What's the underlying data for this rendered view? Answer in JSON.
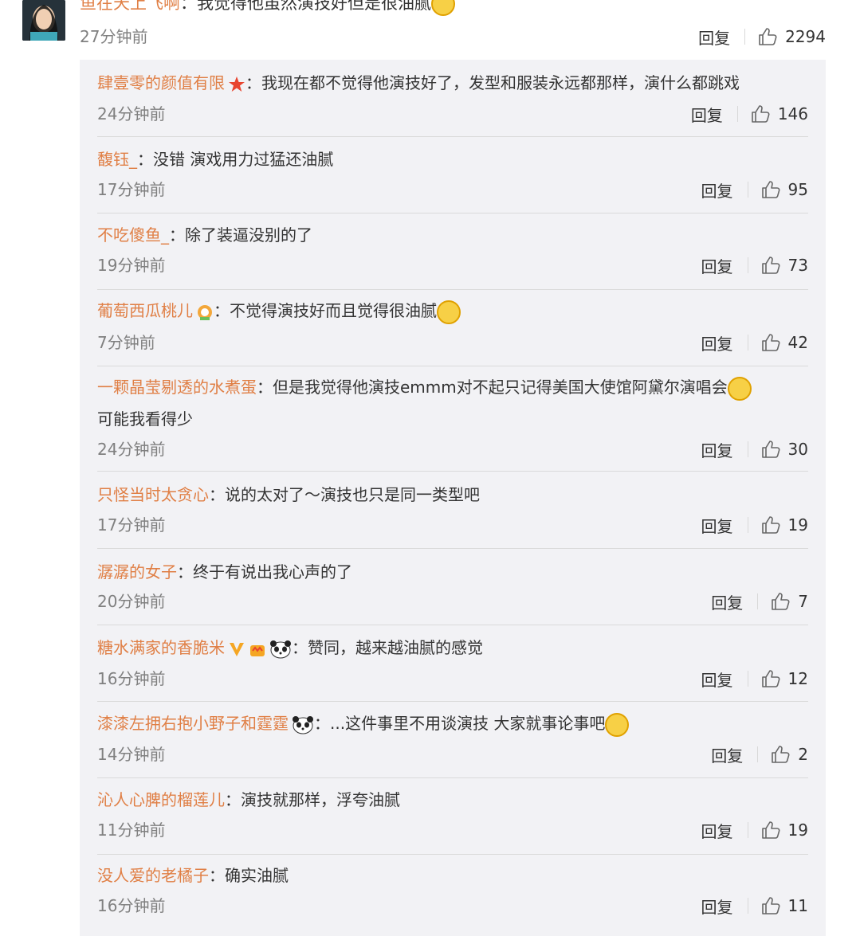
{
  "top_comment": {
    "user": "鱼在天上飞啊",
    "text": "：我觉得他虽然演技好但是很油腻",
    "time": "27分钟前",
    "reply_label": "回复",
    "likes": "2294"
  },
  "replies": [
    {
      "user": "肆壹零的颜值有限",
      "text": "：我现在都不觉得他演技好了，发型和服装永远都那样，演什么都跳戏",
      "time": "24分钟前",
      "reply_label": "回复",
      "likes": "146"
    },
    {
      "user": "馥钰_",
      "text": "：没错 演戏用力过猛还油腻",
      "time": "17分钟前",
      "reply_label": "回复",
      "likes": "95"
    },
    {
      "user": "不吃傻鱼_",
      "text": "：除了装逼没别的了",
      "time": "19分钟前",
      "reply_label": "回复",
      "likes": "73"
    },
    {
      "user": "葡萄西瓜桃儿",
      "text": "：不觉得演技好而且觉得很油腻",
      "time": "7分钟前",
      "reply_label": "回复",
      "likes": "42"
    },
    {
      "user": "一颗晶莹剔透的水煮蛋",
      "text": "：但是我觉得他演技emmm对不起只记得美国大使馆阿黛尔演唱会",
      "text2": "可能我看得少",
      "time": "24分钟前",
      "reply_label": "回复",
      "likes": "30"
    },
    {
      "user": "只怪当时太贪心",
      "text": "：说的太对了～演技也只是同一类型吧",
      "time": "17分钟前",
      "reply_label": "回复",
      "likes": "19"
    },
    {
      "user": "潺潺的女子",
      "text": "：终于有说出我心声的了",
      "time": "20分钟前",
      "reply_label": "回复",
      "likes": "7"
    },
    {
      "user": "糖水满家的香脆米",
      "text": "：赞同，越来越油腻的感觉",
      "time": "16分钟前",
      "reply_label": "回复",
      "likes": "12"
    },
    {
      "user": "漆漆左拥右抱小野子和霆霆",
      "text": "：...这件事里不用谈演技 大家就事论事吧",
      "time": "14分钟前",
      "reply_label": "回复",
      "likes": "2"
    },
    {
      "user": "沁人心脾的榴莲儿",
      "text": "：演技就那样，浮夸油腻",
      "time": "11分钟前",
      "reply_label": "回复",
      "likes": "19"
    },
    {
      "user": "没人爱的老橘子",
      "text": "：确实油腻",
      "time": "16分钟前",
      "reply_label": "回复",
      "likes": "11"
    }
  ],
  "colors": {
    "username": "#e07f45",
    "reply_bg": "#f2f2f5",
    "meta": "#808080"
  }
}
